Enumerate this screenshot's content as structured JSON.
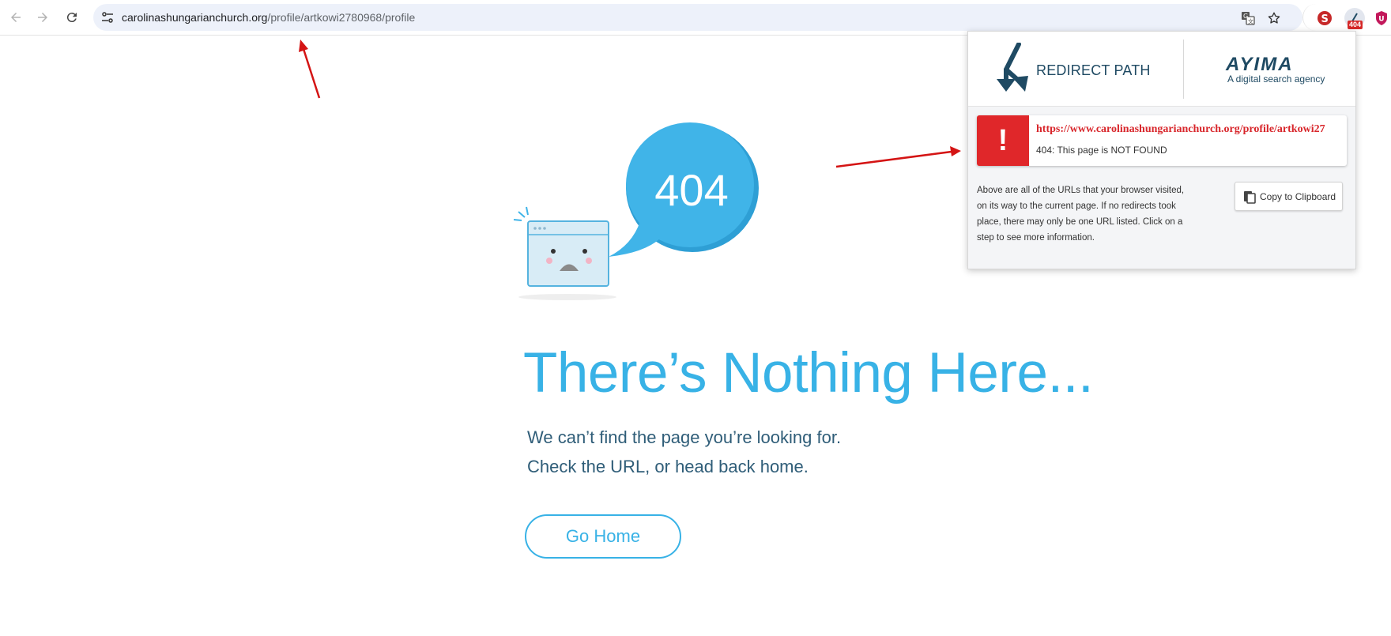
{
  "browser": {
    "url_host": "carolinashungarianchurch.org",
    "url_path": "/profile/artkowi2780968/profile",
    "icons": {
      "back": "back-arrow-icon",
      "forward": "forward-arrow-icon",
      "reload": "reload-icon",
      "site_info": "tune-icon",
      "translate": "translate-icon",
      "bookmark": "star-icon"
    },
    "extensions": {
      "badge": "404"
    }
  },
  "page": {
    "bubble_text": "404",
    "headline": "There’s Nothing Here...",
    "sub_line_1": "We can’t find the page you’re looking for.",
    "sub_line_2": "Check the URL, or head back home.",
    "button_label": "Go Home",
    "accent_color": "#38b2e6"
  },
  "popup": {
    "brand_title": "REDIRECT PATH",
    "partner_logo": "AYIMA",
    "partner_tagline": "A digital search agency",
    "entry": {
      "icon_text": "!",
      "url": "https://www.carolinashungarianchurch.org/profile/artkowi27",
      "status": "404: This page is NOT FOUND"
    },
    "info_text": "Above are all of the URLs that your browser visited, on its way to the current page. If no redirects took place, there may only be one URL listed. Click on a step to see more information.",
    "copy_label": "Copy to Clipboard",
    "error_color": "#e0272a"
  }
}
